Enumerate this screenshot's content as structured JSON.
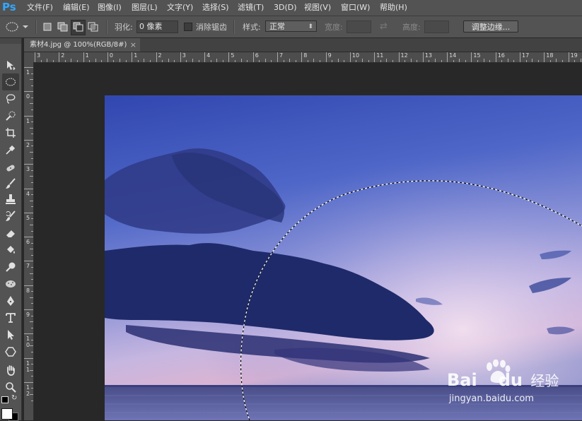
{
  "app": {
    "logo": "Ps"
  },
  "menu": [
    "文件(F)",
    "编辑(E)",
    "图像(I)",
    "图层(L)",
    "文字(Y)",
    "选择(S)",
    "滤镜(T)",
    "3D(D)",
    "视图(V)",
    "窗口(W)",
    "帮助(H)"
  ],
  "options": {
    "feather_label": "羽化:",
    "feather_value": "0 像素",
    "antialias_label": "消除锯齿",
    "style_label": "样式:",
    "style_value": "正常",
    "width_label": "宽度:",
    "height_label": "高度:",
    "refine_edge_button": "调整边缘..."
  },
  "document": {
    "tab_title": "素材4.jpg @ 100%(RGB/8#)",
    "close": "×"
  },
  "ruler": {
    "h_labels": [
      "3",
      "2",
      "1",
      "0",
      "1",
      "2",
      "3",
      "4",
      "5",
      "6",
      "7",
      "8",
      "9",
      "10",
      "11",
      "12",
      "13",
      "14",
      "15",
      "16",
      "17",
      "18",
      "19",
      "20"
    ],
    "v_labels": [
      "1",
      "0",
      "1",
      "2",
      "3",
      "4",
      "5",
      "6",
      "7",
      "8",
      "9",
      "1\n0",
      "1\n1",
      "1\n2"
    ]
  },
  "watermark": {
    "brand_left": "Bai",
    "brand_right": "du",
    "brand_cn": "经验",
    "url": "jingyan.baidu.com"
  },
  "colors": {
    "accent": "#31a8ff",
    "ui_dark": "#535353",
    "canvas_bg": "#282828",
    "baidu_red": "#de2910"
  },
  "icons": [
    "move-icon",
    "elliptical-marquee-icon",
    "lasso-icon",
    "quick-selection-icon",
    "crop-icon",
    "eyedropper-icon",
    "spot-healing-icon",
    "brush-icon",
    "clone-stamp-icon",
    "history-brush-icon",
    "eraser-icon",
    "paint-bucket-icon",
    "dodge-icon",
    "sponge-icon",
    "pen-icon",
    "type-icon",
    "path-selection-icon",
    "shape-icon",
    "hand-icon",
    "zoom-icon"
  ]
}
